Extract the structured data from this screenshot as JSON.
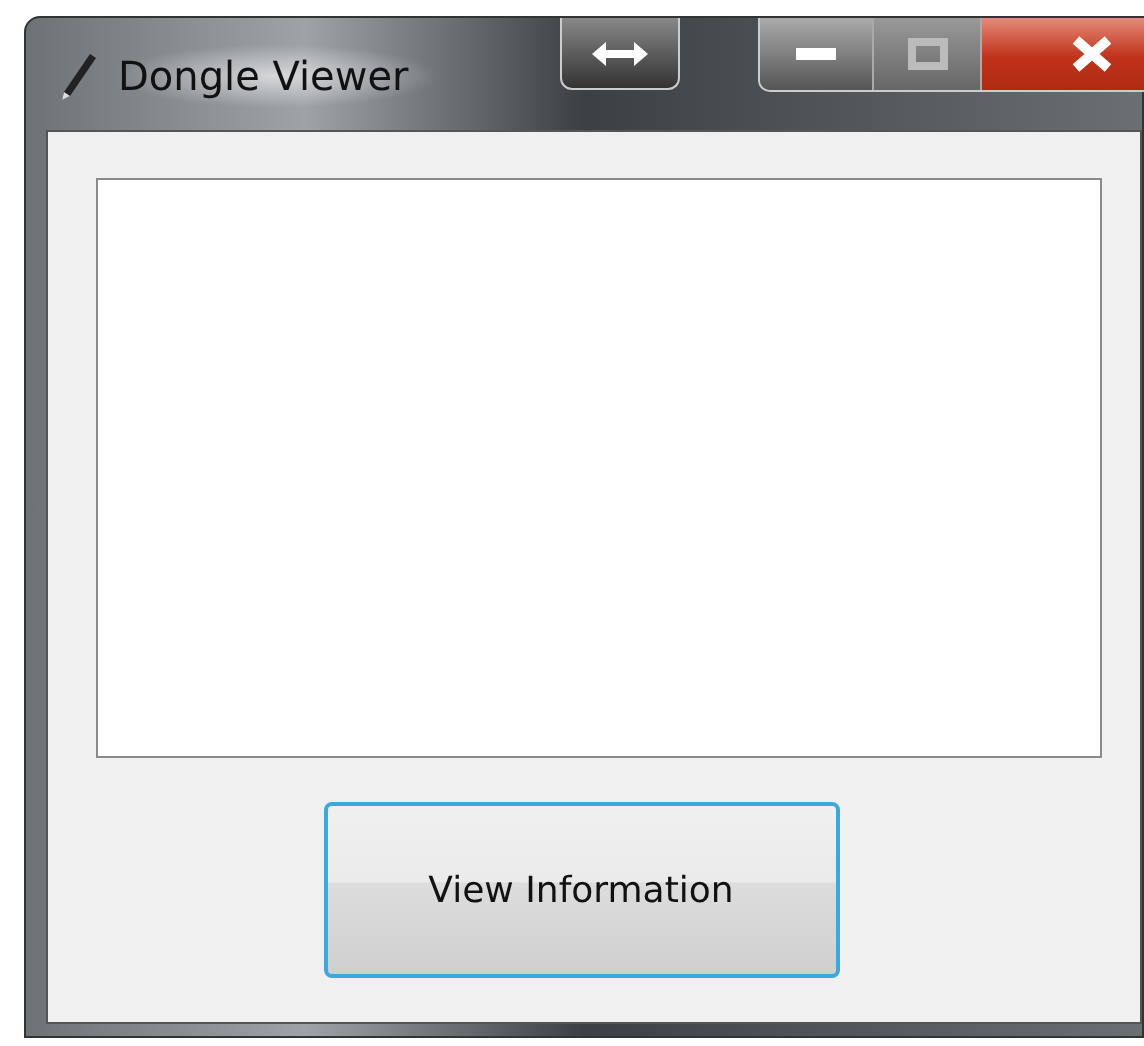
{
  "window": {
    "title": "Dongle Viewer"
  },
  "button": {
    "label": "View Information",
    "focused": true
  }
}
